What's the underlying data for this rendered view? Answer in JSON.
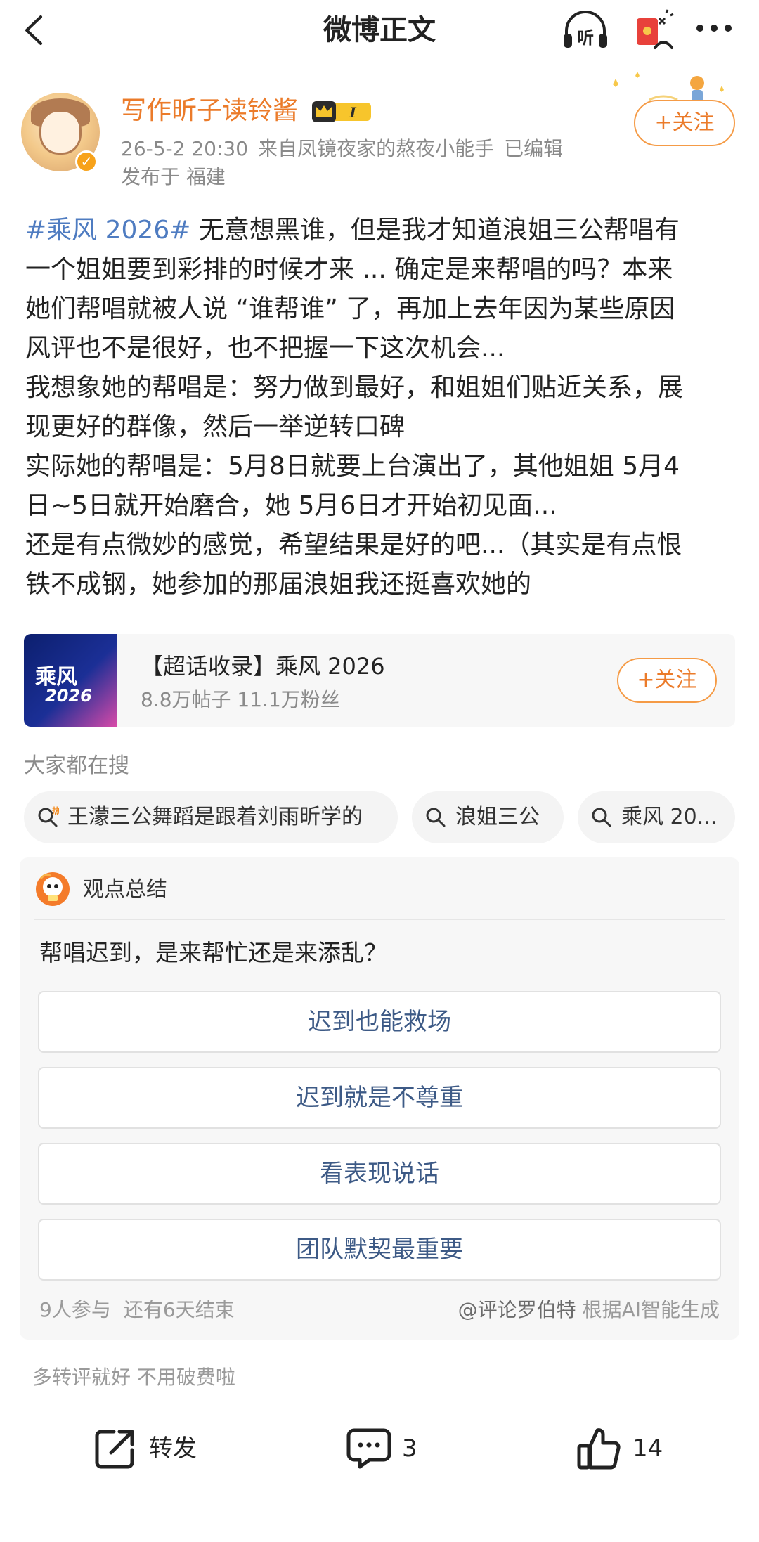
{
  "nav": {
    "title": "微博正文",
    "listen_label": "听"
  },
  "author": {
    "name": "写作昕子读铃酱",
    "vip_level": "I",
    "date": "26-5-2 20:30",
    "source": "来自凤镜夜家的熬夜小能手",
    "edited": "已编辑",
    "location": "发布于 福建",
    "follow_label": "+关注"
  },
  "post": {
    "hashtag": "#乘风 2026#",
    "lines": [
      " 无意想黑谁，但是我才知道浪姐三公帮唱有",
      "一个姐姐要到彩排的时候才来 ... 确定是来帮唱的吗？本来",
      "她们帮唱就被人说 “谁帮谁” 了，再加上去年因为某些原因",
      "风评也不是很好，也不把握一下这次机会...",
      "我想象她的帮唱是：努力做到最好，和姐姐们贴近关系，展",
      "现更好的群像，然后一举逆转口碑",
      "实际她的帮唱是：5月8日就要上台演出了，其他姐姐 5月4",
      "日~5日就开始磨合，她 5月6日才开始初见面...",
      "还是有点微妙的感觉，希望结果是好的吧...（其实是有点恨",
      "铁不成钢，她参加的那届浪姐我还挺喜欢她的"
    ]
  },
  "topic_card": {
    "thumb_line1": "乘风",
    "thumb_line2": "2026",
    "title": "【超话收录】乘风 2026",
    "stats": "8.8万帖子 11.1万粉丝",
    "follow_label": "+关注"
  },
  "search": {
    "label": "大家都在搜",
    "hot_badge": "热",
    "chips": [
      "王濛三公舞蹈是跟着刘雨昕学的",
      "浪姐三公",
      "乘风 20..."
    ]
  },
  "opinion": {
    "title": "观点总结",
    "question": "帮唱迟到，是来帮忙还是来添乱？",
    "options": [
      "迟到也能救场",
      "迟到就是不尊重",
      "看表现说话",
      "团队默契最重要"
    ],
    "participants": "9人参与",
    "ends": "还有6天结束",
    "credit_user": "@评论罗伯特",
    "credit_note": " 根据AI智能生成"
  },
  "footnote": "多转评就好 不用破费啦",
  "actions": {
    "repost_label": "转发",
    "comment_count": "3",
    "like_count": "14"
  },
  "colors": {
    "accent_orange": "#eb7b2a",
    "link_blue": "#4f7cc1",
    "option_text": "#3d5a86"
  }
}
